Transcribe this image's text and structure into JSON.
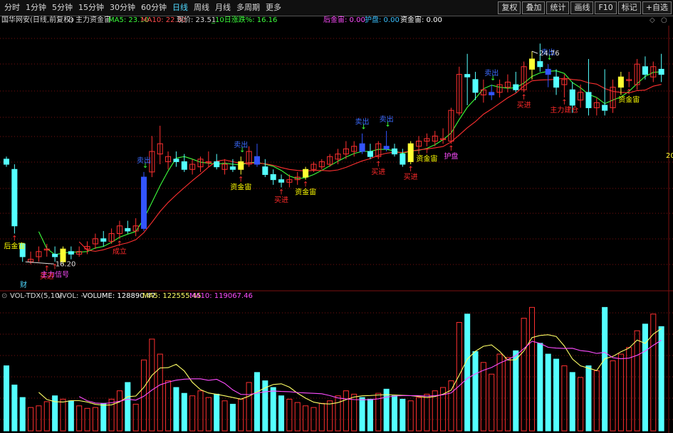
{
  "toolbar": {
    "tabs": [
      "分时",
      "1分钟",
      "5分钟",
      "15分钟",
      "30分钟",
      "60分钟",
      "日线",
      "周线",
      "月线",
      "多周期",
      "更多"
    ],
    "active_tab": "日线",
    "right_buttons": [
      "复权",
      "叠加",
      "统计",
      "画线",
      "F10",
      "标记",
      "+自选"
    ]
  },
  "info": {
    "stock": "国华网安(日线,前复权)",
    "indicator": "主力资金宙",
    "ma5": "MA5: 23.10",
    "ma10": "MA10: 22.30",
    "price": "现价: 23.51",
    "pct10": "_10日涨跌%: 16.16",
    "hjd": "后金宙: 0.00",
    "hp": "护盘: 0.00",
    "zjd": "资金宙: 0.00"
  },
  "volume_info": {
    "name": "VOL-TDX(5,10)",
    "vvol": "VVOL: -",
    "volume": "VOLUME: 128890.47",
    "ma5": "MA5: 122555.45",
    "ma10": "MA10: 119067.46"
  },
  "chart_labels": {
    "high_price": "24.76",
    "low_price": "16.20",
    "cai": "财",
    "right_edge": "20"
  },
  "signals": [
    {
      "text": "后金宙",
      "color": "#ffff00",
      "bar": 1,
      "pos": "below"
    },
    {
      "text": "买进",
      "color": "#ff2a2a",
      "bar": 5,
      "pos": "below2"
    },
    {
      "text": "主力信号",
      "color": "#ff4dff",
      "bar": 6,
      "pos": "below"
    },
    {
      "text": "成立",
      "color": "#ff2a2a",
      "bar": 14,
      "pos": "below"
    },
    {
      "text": "卖出",
      "color": "#3b6bff",
      "bar": 17,
      "pos": "above"
    },
    {
      "text": "卖出",
      "color": "#3b6bff",
      "bar": 29,
      "pos": "above"
    },
    {
      "text": "资金宙",
      "color": "#ffff00",
      "bar": 29,
      "pos": "below"
    },
    {
      "text": "买进",
      "color": "#ff2a2a",
      "bar": 34,
      "pos": "below"
    },
    {
      "text": "资金宙",
      "color": "#ffff00",
      "bar": 37,
      "pos": "below"
    },
    {
      "text": "卖出",
      "color": "#3b6bff",
      "bar": 44,
      "pos": "above"
    },
    {
      "text": "卖出",
      "color": "#3b6bff",
      "bar": 47,
      "pos": "above"
    },
    {
      "text": "买进",
      "color": "#ff2a2a",
      "bar": 46,
      "pos": "below"
    },
    {
      "text": "买进",
      "color": "#ff2a2a",
      "bar": 50,
      "pos": "below"
    },
    {
      "text": "资金宙",
      "color": "#ffff00",
      "bar": 52,
      "pos": "below"
    },
    {
      "text": "护盘",
      "color": "#ff4dff",
      "bar": 55,
      "pos": "below"
    },
    {
      "text": "卖出",
      "color": "#3b6bff",
      "bar": 60,
      "pos": "above"
    },
    {
      "text": "买进",
      "color": "#ff2a2a",
      "bar": 64,
      "pos": "below"
    },
    {
      "text": "卖出",
      "color": "#3b6bff",
      "bar": 67,
      "pos": "above"
    },
    {
      "text": "主力建仓",
      "color": "#ff2a2a",
      "bar": 69,
      "pos": "below"
    },
    {
      "text": "资金宙",
      "color": "#ffff00",
      "bar": 77,
      "pos": "below"
    }
  ],
  "chart_data": {
    "type": "candlestick",
    "price_range": [
      15.2,
      25.5
    ],
    "candles": [
      {
        "o": 20.3,
        "h": 20.4,
        "l": 20.0,
        "c": 20.1
      },
      {
        "o": 19.9,
        "h": 20.1,
        "l": 17.4,
        "c": 17.7
      },
      {
        "o": 17.0,
        "h": 17.0,
        "l": 16.3,
        "c": 16.5
      },
      {
        "o": 16.3,
        "h": 16.7,
        "l": 16.2,
        "c": 16.4
      },
      {
        "o": 16.5,
        "h": 16.9,
        "l": 16.3,
        "c": 16.7
      },
      {
        "o": 16.8,
        "h": 17.0,
        "l": 16.5,
        "c": 16.8
      },
      {
        "o": 16.6,
        "h": 16.9,
        "l": 16.3,
        "c": 16.5
      },
      {
        "o": 16.3,
        "h": 16.9,
        "l": 16.2,
        "c": 16.8
      },
      {
        "o": 16.7,
        "h": 16.9,
        "l": 16.4,
        "c": 16.6
      },
      {
        "o": 16.6,
        "h": 16.9,
        "l": 16.5,
        "c": 16.7
      },
      {
        "o": 16.8,
        "h": 17.1,
        "l": 16.6,
        "c": 16.9
      },
      {
        "o": 17.0,
        "h": 17.4,
        "l": 16.8,
        "c": 17.2
      },
      {
        "o": 17.2,
        "h": 17.5,
        "l": 16.9,
        "c": 17.1
      },
      {
        "o": 17.1,
        "h": 17.6,
        "l": 17.0,
        "c": 17.4
      },
      {
        "o": 17.4,
        "h": 17.9,
        "l": 17.2,
        "c": 17.7
      },
      {
        "o": 17.6,
        "h": 17.9,
        "l": 17.4,
        "c": 17.5
      },
      {
        "o": 17.5,
        "h": 18.0,
        "l": 17.3,
        "c": 17.7
      },
      {
        "o": 17.6,
        "h": 19.8,
        "l": 17.5,
        "c": 19.6
      },
      {
        "o": 19.8,
        "h": 21.2,
        "l": 19.6,
        "c": 20.6
      },
      {
        "o": 20.5,
        "h": 21.6,
        "l": 20.1,
        "c": 20.9
      },
      {
        "o": 20.2,
        "h": 20.6,
        "l": 19.9,
        "c": 20.4
      },
      {
        "o": 20.3,
        "h": 20.6,
        "l": 20.0,
        "c": 20.2
      },
      {
        "o": 20.2,
        "h": 20.5,
        "l": 19.8,
        "c": 19.9
      },
      {
        "o": 19.9,
        "h": 20.3,
        "l": 19.7,
        "c": 20.1
      },
      {
        "o": 20.0,
        "h": 20.4,
        "l": 19.8,
        "c": 20.3
      },
      {
        "o": 20.2,
        "h": 20.6,
        "l": 20.0,
        "c": 20.2
      },
      {
        "o": 20.2,
        "h": 20.5,
        "l": 19.9,
        "c": 20.0
      },
      {
        "o": 19.9,
        "h": 20.3,
        "l": 19.7,
        "c": 20.1
      },
      {
        "o": 20.0,
        "h": 20.3,
        "l": 19.8,
        "c": 19.9
      },
      {
        "o": 19.9,
        "h": 20.4,
        "l": 19.7,
        "c": 20.2
      },
      {
        "o": 20.1,
        "h": 20.8,
        "l": 20.0,
        "c": 20.6
      },
      {
        "o": 20.4,
        "h": 20.9,
        "l": 20.0,
        "c": 20.1
      },
      {
        "o": 20.0,
        "h": 20.3,
        "l": 19.6,
        "c": 19.7
      },
      {
        "o": 19.7,
        "h": 19.9,
        "l": 19.3,
        "c": 19.5
      },
      {
        "o": 19.5,
        "h": 19.7,
        "l": 19.2,
        "c": 19.4
      },
      {
        "o": 19.4,
        "h": 19.7,
        "l": 19.2,
        "c": 19.5
      },
      {
        "o": 19.5,
        "h": 19.8,
        "l": 19.3,
        "c": 19.6
      },
      {
        "o": 19.6,
        "h": 20.0,
        "l": 19.5,
        "c": 19.9
      },
      {
        "o": 19.9,
        "h": 20.2,
        "l": 19.8,
        "c": 20.1
      },
      {
        "o": 20.0,
        "h": 20.3,
        "l": 19.9,
        "c": 20.2
      },
      {
        "o": 20.1,
        "h": 20.5,
        "l": 20.0,
        "c": 20.4
      },
      {
        "o": 20.3,
        "h": 20.7,
        "l": 20.1,
        "c": 20.5
      },
      {
        "o": 20.5,
        "h": 21.0,
        "l": 20.3,
        "c": 20.7
      },
      {
        "o": 20.6,
        "h": 21.0,
        "l": 20.4,
        "c": 20.8
      },
      {
        "o": 20.9,
        "h": 21.3,
        "l": 20.5,
        "c": 20.6
      },
      {
        "o": 20.6,
        "h": 20.9,
        "l": 20.3,
        "c": 20.4
      },
      {
        "o": 20.4,
        "h": 21.0,
        "l": 20.3,
        "c": 20.9
      },
      {
        "o": 20.8,
        "h": 21.4,
        "l": 20.6,
        "c": 20.7
      },
      {
        "o": 20.7,
        "h": 20.9,
        "l": 20.4,
        "c": 20.5
      },
      {
        "o": 20.5,
        "h": 20.7,
        "l": 20.0,
        "c": 20.1
      },
      {
        "o": 20.2,
        "h": 21.0,
        "l": 20.1,
        "c": 20.9
      },
      {
        "o": 20.8,
        "h": 21.2,
        "l": 20.5,
        "c": 21.0
      },
      {
        "o": 21.0,
        "h": 21.3,
        "l": 20.8,
        "c": 21.1
      },
      {
        "o": 21.0,
        "h": 21.4,
        "l": 20.8,
        "c": 21.2
      },
      {
        "o": 21.1,
        "h": 21.5,
        "l": 20.9,
        "c": 21.1
      },
      {
        "o": 21.0,
        "h": 22.3,
        "l": 20.9,
        "c": 22.2
      },
      {
        "o": 22.1,
        "h": 23.9,
        "l": 22.0,
        "c": 23.6
      },
      {
        "o": 23.6,
        "h": 24.4,
        "l": 22.4,
        "c": 23.5
      },
      {
        "o": 23.4,
        "h": 23.7,
        "l": 22.6,
        "c": 22.9
      },
      {
        "o": 22.8,
        "h": 23.4,
        "l": 22.5,
        "c": 23.0
      },
      {
        "o": 22.8,
        "h": 23.2,
        "l": 22.6,
        "c": 22.9
      },
      {
        "o": 22.9,
        "h": 23.4,
        "l": 22.7,
        "c": 23.2
      },
      {
        "o": 23.1,
        "h": 23.6,
        "l": 22.9,
        "c": 23.3
      },
      {
        "o": 23.2,
        "h": 23.7,
        "l": 22.9,
        "c": 23.0
      },
      {
        "o": 23.0,
        "h": 24.1,
        "l": 22.9,
        "c": 23.9
      },
      {
        "o": 23.8,
        "h": 24.5,
        "l": 23.4,
        "c": 24.2
      },
      {
        "o": 24.1,
        "h": 24.8,
        "l": 23.7,
        "c": 23.9
      },
      {
        "o": 23.8,
        "h": 24.0,
        "l": 23.1,
        "c": 23.6
      },
      {
        "o": 23.5,
        "h": 23.8,
        "l": 22.8,
        "c": 23.1
      },
      {
        "o": 23.2,
        "h": 23.6,
        "l": 22.7,
        "c": 23.4
      },
      {
        "o": 23.0,
        "h": 23.3,
        "l": 22.1,
        "c": 22.4
      },
      {
        "o": 22.6,
        "h": 23.2,
        "l": 22.3,
        "c": 22.9
      },
      {
        "o": 22.9,
        "h": 24.2,
        "l": 22.0,
        "c": 22.3
      },
      {
        "o": 22.3,
        "h": 22.7,
        "l": 22.0,
        "c": 22.5
      },
      {
        "o": 22.4,
        "h": 23.8,
        "l": 22.0,
        "c": 22.2
      },
      {
        "o": 22.3,
        "h": 23.4,
        "l": 22.1,
        "c": 23.1
      },
      {
        "o": 23.1,
        "h": 23.7,
        "l": 22.8,
        "c": 23.5
      },
      {
        "o": 23.4,
        "h": 23.7,
        "l": 23.1,
        "c": 23.4
      },
      {
        "o": 23.2,
        "h": 24.2,
        "l": 23.0,
        "c": 24.0
      },
      {
        "o": 23.9,
        "h": 24.3,
        "l": 23.4,
        "c": 23.6
      },
      {
        "o": 23.5,
        "h": 24.1,
        "l": 23.3,
        "c": 23.9
      },
      {
        "o": 23.8,
        "h": 24.4,
        "l": 23.3,
        "c": 23.6
      }
    ],
    "volume": [
      78,
      55,
      40,
      28,
      30,
      35,
      42,
      38,
      36,
      30,
      27,
      28,
      33,
      38,
      48,
      58,
      32,
      85,
      110,
      92,
      60,
      52,
      45,
      42,
      48,
      40,
      44,
      36,
      32,
      38,
      58,
      70,
      60,
      52,
      42,
      38,
      34,
      30,
      28,
      33,
      36,
      42,
      48,
      44,
      40,
      38,
      45,
      50,
      42,
      38,
      36,
      40,
      44,
      48,
      52,
      60,
      130,
      140,
      95,
      82,
      68,
      92,
      88,
      96,
      135,
      148,
      105,
      92,
      86,
      78,
      70,
      64,
      78,
      72,
      148,
      84,
      92,
      100,
      120,
      128,
      140,
      125
    ],
    "volume_range": [
      0,
      150
    ]
  }
}
